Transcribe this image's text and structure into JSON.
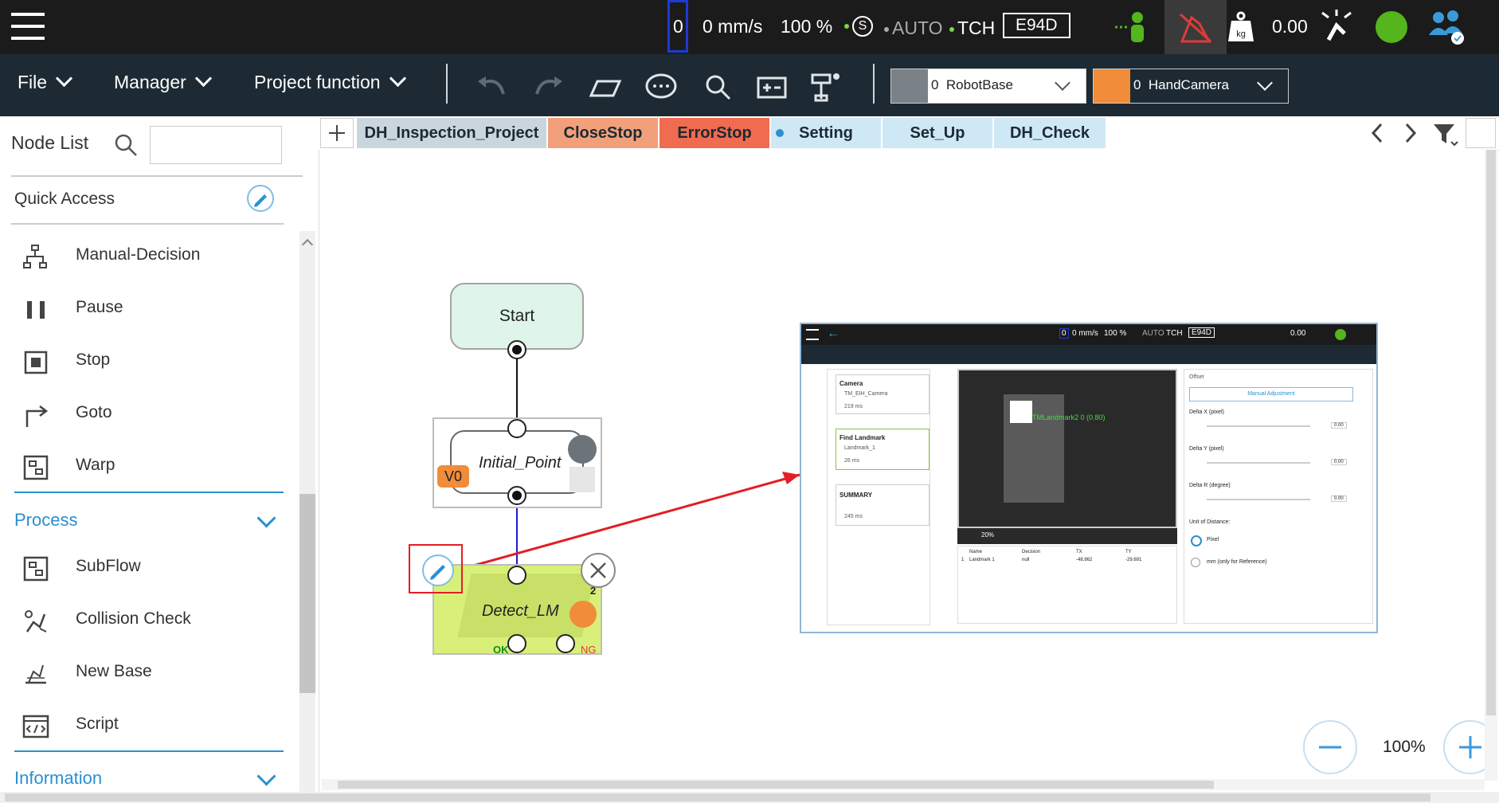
{
  "status_bar": {
    "counter": "0",
    "speed": "0 mm/s",
    "percent": "100 %",
    "safety_symbol": "S",
    "mode_auto": "AUTO",
    "mode_tch": "TCH",
    "code": "E94D",
    "payload_unit": "kg",
    "payload_value": "0.00",
    "colors": {
      "status_green": "#54b51c",
      "alert_red": "#e03a3a",
      "auto_dot": "#7cd44b"
    }
  },
  "menubar": {
    "file": "File",
    "manager": "Manager",
    "project_function": "Project function",
    "base_dropdown": "0  RobotBase",
    "camera_dropdown": "0  HandCamera"
  },
  "sidebar": {
    "node_list_label": "Node List",
    "search_placeholder": "",
    "quick_access_label": "Quick Access",
    "quick_items": [
      {
        "label": "Manual-Decision",
        "icon": "decision-tree-icon"
      },
      {
        "label": "Pause",
        "icon": "pause-icon"
      },
      {
        "label": "Stop",
        "icon": "stop-icon"
      },
      {
        "label": "Goto",
        "icon": "goto-arrow-icon"
      },
      {
        "label": "Warp",
        "icon": "warp-icon"
      }
    ],
    "process_label": "Process",
    "process_items": [
      {
        "label": "SubFlow",
        "icon": "subflow-icon"
      },
      {
        "label": "Collision Check",
        "icon": "collision-check-icon"
      },
      {
        "label": "New Base",
        "icon": "new-base-icon"
      },
      {
        "label": "Script",
        "icon": "script-icon"
      }
    ],
    "information_label": "Information"
  },
  "tabs": [
    {
      "label": "DH_Inspection_Project",
      "bg": "#c9d6dd"
    },
    {
      "label": "CloseStop",
      "bg": "#f2a07b"
    },
    {
      "label": "ErrorStop",
      "bg": "#f06b50"
    },
    {
      "label": "Setting",
      "bg": "#cfe8f6"
    },
    {
      "label": "Set_Up",
      "bg": "#cfe8f6"
    },
    {
      "label": "DH_Check",
      "bg": "#cfe8f6"
    }
  ],
  "flow": {
    "start_label": "Start",
    "initial_point_label": "Initial_Point",
    "point_badge": "V0",
    "detect_label": "Detect_LM",
    "detect_count": "2",
    "ok_label": "OK",
    "ng_label": "NG"
  },
  "zoom": {
    "value": "100%"
  },
  "inset": {
    "counter": "0",
    "speed": "0 mm/s",
    "percent": "100 %",
    "mode_auto": "AUTO",
    "mode_tch": "TCH",
    "code": "E94D",
    "payload": "0.00",
    "steps": [
      {
        "title": "Camera",
        "sub": "TM_EIH_Camera",
        "time": "219 ms"
      },
      {
        "title": "Find Landmark",
        "sub": "Landmark_1",
        "time": "26 ms"
      },
      {
        "title": "SUMMARY",
        "sub": "",
        "time": "245 ms"
      }
    ],
    "overlay_text": "TMLandmark2 0 (0.80)",
    "image_zoom": "20%",
    "table_headers": [
      "Name",
      "Decision",
      "TX",
      "TY"
    ],
    "table_row": [
      "1",
      "Landmark 1",
      "null",
      "-48.862",
      "-29.691"
    ],
    "offset_label": "Offset",
    "manual_adjustment": "Manual Adjustment",
    "delta_x_label": "Delta X (pixel)",
    "delta_x_value": "0.00",
    "delta_y_label": "Delta Y (pixel)",
    "delta_y_value": "0.00",
    "delta_r_label": "Delta R (degree)",
    "delta_r_value": "0.00",
    "unit_label": "Unit of Distance:",
    "unit_pixel": "Pixel",
    "unit_mm": "mm (only for Reference)"
  }
}
